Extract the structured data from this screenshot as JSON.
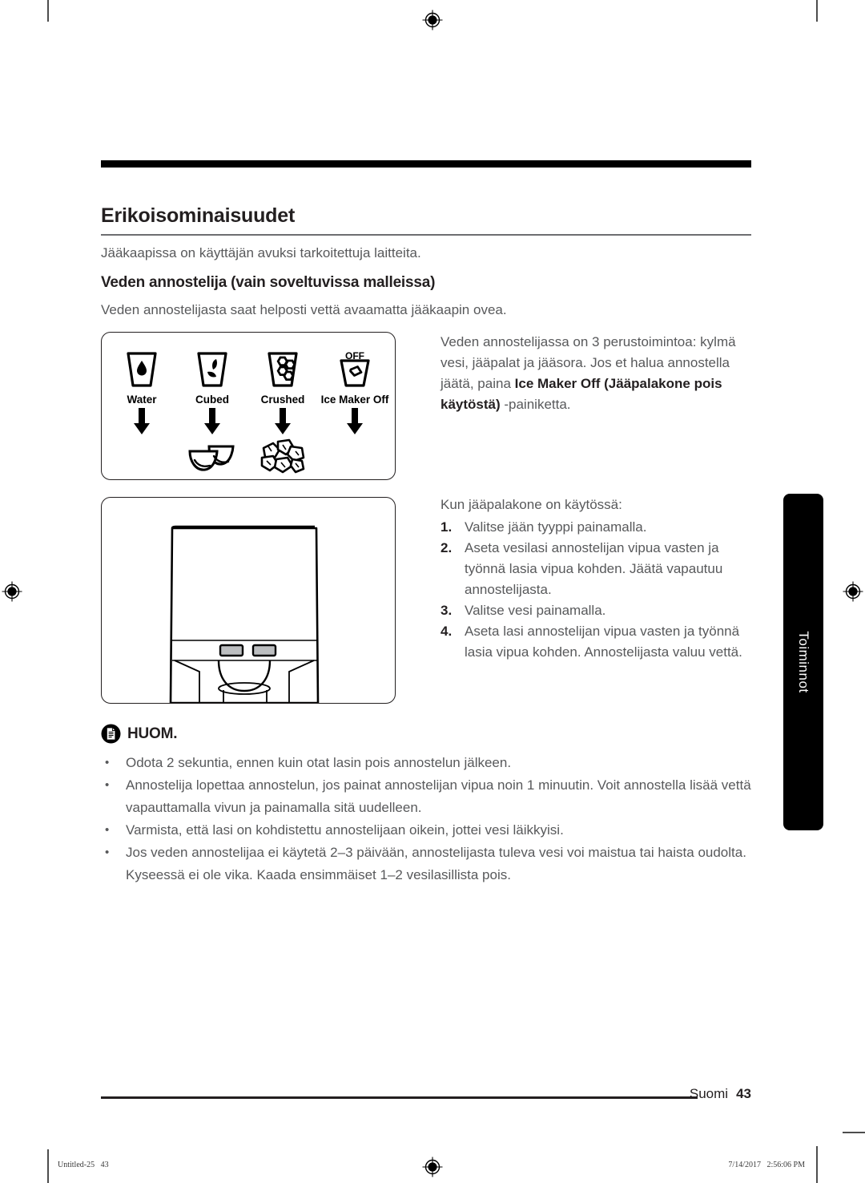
{
  "document": {
    "top_rule": true,
    "page_title": "Erikoisominaisuudet",
    "intro_text": "Jääkaapissa on käyttäjän avuksi tarkoitettuja laitteita.",
    "sub_title": "Veden annostelija (vain soveltuvissa malleissa)",
    "sub_text": "Veden annostelijasta saat helposti vettä avaamatta jääkaapin ovea."
  },
  "figure_icons": {
    "columns": [
      {
        "icon": "water-glass-icon",
        "label": "Water",
        "arrow": true,
        "output": "none"
      },
      {
        "icon": "cubed-ice-glass-icon",
        "label": "Cubed",
        "arrow": true,
        "output": "ice-cubes-icon"
      },
      {
        "icon": "crushed-ice-glass-icon",
        "label": "Crushed",
        "arrow": true,
        "output": "crushed-ice-icon"
      },
      {
        "icon": "ice-maker-off-glass-icon",
        "label": "Ice Maker Off",
        "arrow": true,
        "output": "none",
        "badge": "OFF"
      }
    ]
  },
  "figure_dispenser": {
    "name": "water-dispenser-illustration"
  },
  "right_column": {
    "paragraph_1": {
      "part1": "Veden annostelijassa on 3 perustoimintoa: kylmä vesi, jääpalat ja jääsora. Jos et halua annostella jäätä, paina ",
      "bold1": "Ice Maker Off",
      "part2": " ",
      "bold2": "(Jääpalakone pois käytöstä)",
      "part3": " -painiketta."
    },
    "steps_intro": "Kun jääpalakone on käytössä:",
    "steps": [
      {
        "num": "1.",
        "text": "Valitse jään tyyppi painamalla."
      },
      {
        "num": "2.",
        "text": "Aseta vesilasi annostelijan vipua vasten ja työnnä lasia vipua kohden. Jäätä vapautuu annostelijasta."
      },
      {
        "num": "3.",
        "text": "Valitse vesi painamalla."
      },
      {
        "num": "4.",
        "text": "Aseta lasi annostelijan vipua vasten ja työnnä lasia vipua kohden. Annostelijasta valuu vettä."
      }
    ]
  },
  "note": {
    "icon": "note-document-icon",
    "label": "HUOM.",
    "bullet": "•",
    "items": [
      "Odota 2 sekuntia, ennen kuin otat lasin pois annostelun jälkeen.",
      "Annostelija lopettaa annostelun, jos painat annostelijan vipua noin 1 minuutin. Voit annostella lisää vettä vapauttamalla vivun ja painamalla sitä uudelleen.",
      "Varmista, että lasi on kohdistettu annostelijaan oikein, jottei vesi läikkyisi.",
      "Jos veden annostelijaa ei käytetä 2–3 päivään, annostelijasta tuleva vesi voi maistua tai haista oudolta. Kyseessä ei ole vika. Kaada ensimmäiset 1–2 vesilasillista pois."
    ]
  },
  "side_tab": {
    "label": "Toiminnot"
  },
  "footer": {
    "language": "Suomi",
    "page_number": "43"
  },
  "print_slug": {
    "left": "Untitled-25   43",
    "right": "7/14/2017   2:56:06 PM"
  },
  "colors": {
    "text": "#231f20",
    "body_text": "#58595b",
    "rule": "#000000",
    "tab_bg": "#000000",
    "tab_text": "#ffffff",
    "button_fill": "#bcbec0"
  }
}
